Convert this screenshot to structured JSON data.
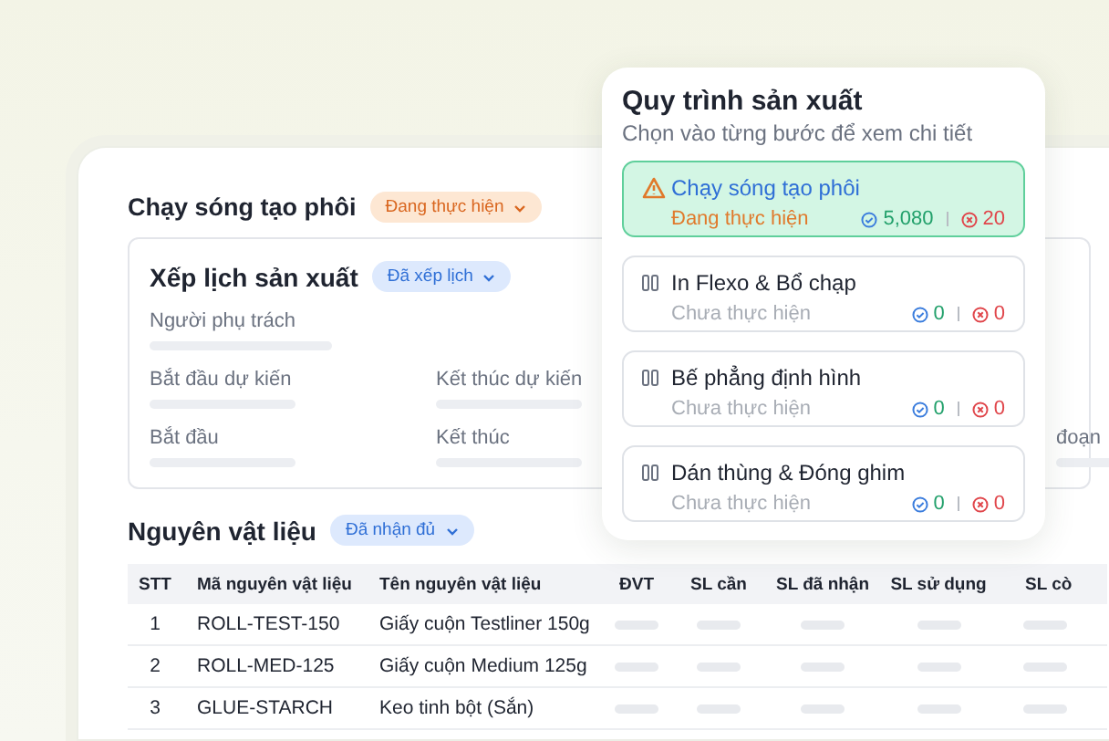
{
  "stage": {
    "title": "Chạy sóng tạo phôi",
    "badge": {
      "label": "Đang thực hiện",
      "kind": "in_progress"
    }
  },
  "schedule": {
    "title": "Xếp lịch sản xuất",
    "badge": {
      "label": "Đã xếp lịch",
      "kind": "scheduled"
    },
    "fields": [
      {
        "label": "Người phụ trách"
      },
      {
        "label": "Bắt đầu dự kiến"
      },
      {
        "label": "Kết thúc dự kiến"
      },
      {
        "label": "Bắt đầu"
      },
      {
        "label": "Kết thúc"
      },
      {
        "label": "đoạn"
      }
    ]
  },
  "materials": {
    "title": "Nguyên vật liệu",
    "badge": {
      "label": "Đã nhận đủ",
      "kind": "scheduled"
    },
    "columns": [
      "STT",
      "Mã nguyên vật liệu",
      "Tên nguyên vật liệu",
      "ĐVT",
      "SL cần",
      "SL đã nhận",
      "SL sử dụng",
      "SL cò"
    ],
    "rows": [
      {
        "stt": "1",
        "code": "ROLL-TEST-150",
        "name": "Giấy cuộn Testliner 150g"
      },
      {
        "stt": "2",
        "code": "ROLL-MED-125",
        "name": "Giấy cuộn Medium 125g"
      },
      {
        "stt": "3",
        "code": "GLUE-STARCH",
        "name": "Keo tinh bột (Sắn)"
      }
    ]
  },
  "process": {
    "title": "Quy trình sản xuất",
    "subtitle": "Chọn vào từng bước để xem chi tiết",
    "steps": [
      {
        "title": "Chạy sóng tạo phôi",
        "status": "Đang thực hiện",
        "kind": "warning",
        "selected": true,
        "done": "5,080",
        "failed": "20"
      },
      {
        "title": "In Flexo & Bổ chạp",
        "status": "Chưa thực hiện",
        "kind": "paused",
        "selected": false,
        "done": "0",
        "failed": "0"
      },
      {
        "title": "Bế phẳng định hình",
        "status": "Chưa thực hiện",
        "kind": "paused",
        "selected": false,
        "done": "0",
        "failed": "0"
      },
      {
        "title": "Dán thùng & Đóng ghim",
        "status": "Chưa thực hiện",
        "kind": "paused",
        "selected": false,
        "done": "0",
        "failed": "0"
      }
    ]
  }
}
